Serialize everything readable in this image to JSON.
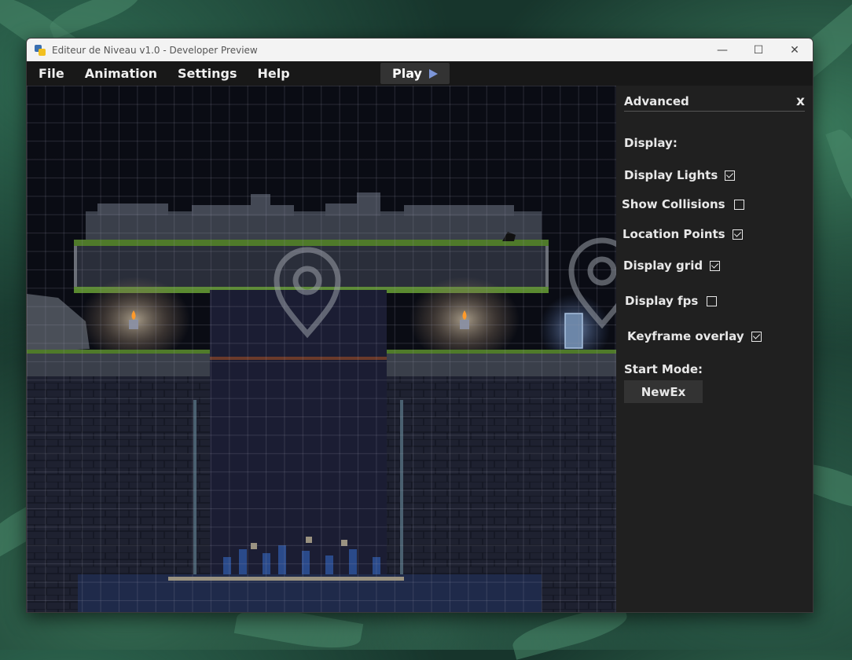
{
  "window": {
    "title": "Editeur de Niveau v1.0 - Developer Preview",
    "controls": {
      "minimize": "—",
      "maximize": "☐",
      "close": "✕"
    }
  },
  "menu": {
    "items": [
      "File",
      "Animation",
      "Settings",
      "Help"
    ],
    "play_label": "Play"
  },
  "panel": {
    "title": "Advanced",
    "close_label": "x",
    "display_section": "Display:",
    "options": [
      {
        "label": "Display Lights",
        "checked": true
      },
      {
        "label": "Show Collisions",
        "checked": false
      },
      {
        "label": "Location Points",
        "checked": true
      },
      {
        "label": "Display grid",
        "checked": true
      },
      {
        "label": "Display fps",
        "checked": false
      },
      {
        "label": "Keyframe overlay",
        "checked": true
      }
    ],
    "start_mode_label": "Start Mode:",
    "start_mode_value": "NewEx"
  },
  "colors": {
    "accent_play": "#7d96d8",
    "panel_bg": "#202020",
    "menubar_bg": "#181818",
    "canvas_bg": "#0a0c14"
  }
}
